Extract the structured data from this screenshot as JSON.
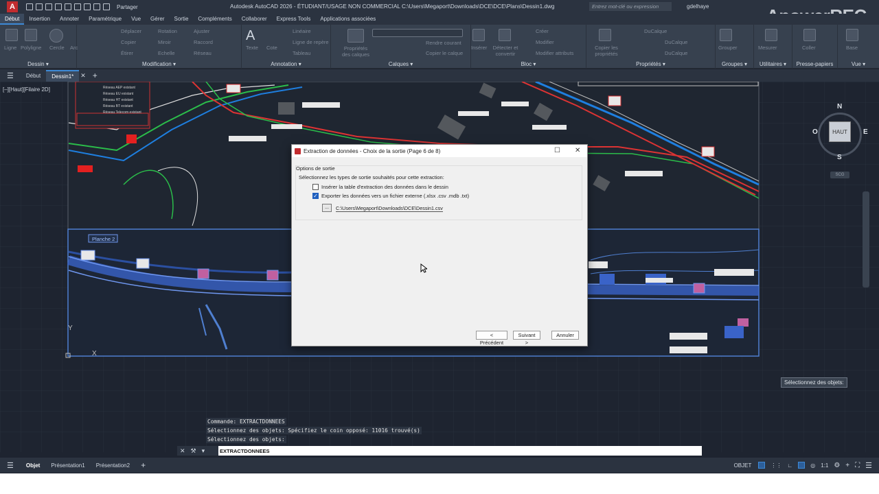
{
  "app": {
    "logo": "A",
    "share": "Partager",
    "window_title": "Autodesk AutoCAD 2026 - ÉTUDIANT/USAGE NON COMMERCIAL   C:\\Users\\Megaport\\Downloads\\DCE\\DCE\\Plans\\Dessin1.dwg",
    "search_placeholder": "Entrez mot-clé ou expression",
    "user": "gdelhaye",
    "watermark": "ApowerREC"
  },
  "ribbon_tabs": [
    "Début",
    "Insertion",
    "Annoter",
    "Paramétrique",
    "Vue",
    "Gérer",
    "Sortie",
    "Compléments",
    "Collaborer",
    "Express Tools",
    "Applications associées"
  ],
  "ribbon": {
    "dessin": {
      "title": "Dessin ▾",
      "items": [
        "Ligne",
        "Polyligne",
        "Cercle",
        "Arc"
      ]
    },
    "modification": {
      "title": "Modification ▾",
      "items": [
        "Déplacer",
        "Rotation",
        "Ajuster",
        "Copier",
        "Miroir",
        "Raccord",
        "Étirer",
        "Echelle",
        "Réseau"
      ]
    },
    "annotation": {
      "title": "Annotation ▾",
      "items": [
        "Texte",
        "Cote",
        "Linéaire",
        "Ligne de repère",
        "Tableau"
      ]
    },
    "calques": {
      "title": "Calques ▾",
      "items": [
        "Propriétés des calques",
        "Rendre courant",
        "Copier le calque"
      ]
    },
    "bloc": {
      "title": "Bloc ▾",
      "items": [
        "Insérer",
        "Créer",
        "Modifier",
        "Modifier attributs",
        "Détecter et convertir"
      ]
    },
    "proprietes": {
      "title": "Propriétés ▾",
      "items": [
        "Copier les propriétés",
        "DuCalque",
        "DuCalque",
        "DuCalque"
      ]
    },
    "groupes": {
      "title": "Groupes ▾",
      "items": [
        "Grouper"
      ]
    },
    "utilitaires": {
      "title": "Utilitaires ▾",
      "items": [
        "Mesurer"
      ]
    },
    "presse": {
      "title": "Presse-papiers",
      "items": [
        "Coller"
      ]
    },
    "vue": {
      "title": "Vue ▾",
      "items": [
        "Base"
      ]
    }
  },
  "doc_tabs": {
    "start": "Début",
    "active": "Dessin1*"
  },
  "view_label": "[–][Haut][Filaire 2D]",
  "viewcube": {
    "n": "N",
    "s": "S",
    "e": "E",
    "w": "O",
    "face": "HAUT",
    "scu": "SCG"
  },
  "drawing": {
    "sheet_label": "Planche 2",
    "legend": [
      "Réseau AEP existant",
      "Réseau EU existant",
      "Réseau HT existant",
      "Réseau BT existant",
      "Réseau Telecom existant"
    ]
  },
  "dialog": {
    "title": "Extraction de données - Choix de la sortie (Page 6 de 8)",
    "group": "Options de sortie",
    "subtitle": "Sélectionnez les types de sortie souhaités pour cette extraction:",
    "opt1": {
      "label": "Insérer la table d'extraction des données dans le dessin",
      "checked": false
    },
    "opt2": {
      "label": "Exporter les données vers un fichier externe (.xlsx .csv .mdb .txt)",
      "checked": true
    },
    "browse": "...",
    "path": "C:\\Users\\Megaport\\Downloads\\DCE\\Dessin1.csv",
    "prev": "< Précédent",
    "next": "Suivant >",
    "cancel": "Annuler"
  },
  "command_history": [
    "Commande: EXTRACTDONNEES",
    "Sélectionnez des objets: Spécifiez le coin opposé: 11016 trouvé(s)",
    "Sélectionnez des objets:"
  ],
  "command_line": "EXTRACTDONNEES",
  "tooltip": "Sélectionnez des objets:",
  "status": {
    "tabs": [
      "Objet",
      "Présentation1",
      "Présentation2"
    ],
    "mode": "OBJET",
    "scale": "1:1"
  }
}
